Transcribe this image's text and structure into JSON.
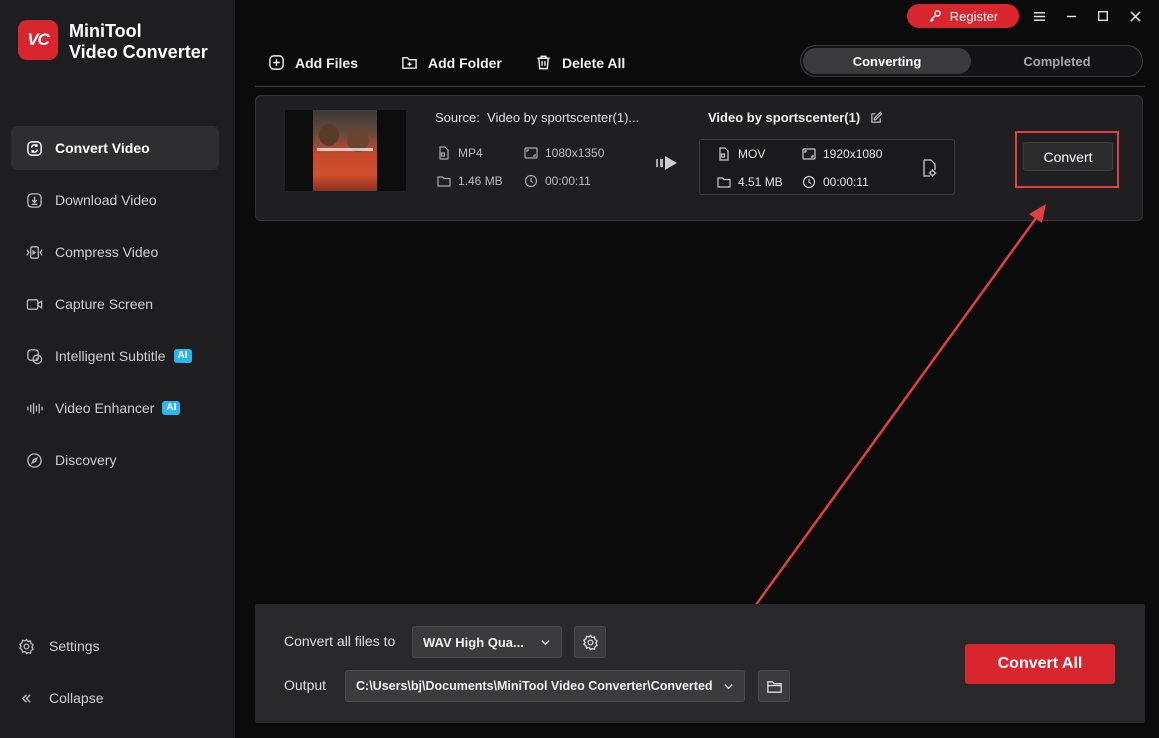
{
  "app": {
    "logo_text": "VC",
    "title_line1": "MiniTool",
    "title_line2": "Video Converter"
  },
  "titlebar": {
    "register_label": "Register"
  },
  "sidebar": {
    "items": [
      {
        "label": "Convert Video",
        "icon": "convert-icon",
        "active": true
      },
      {
        "label": "Download Video",
        "icon": "download-icon"
      },
      {
        "label": "Compress Video",
        "icon": "compress-icon"
      },
      {
        "label": "Capture Screen",
        "icon": "capture-icon"
      },
      {
        "label": "Intelligent Subtitle",
        "icon": "subtitle-icon",
        "badge": "AI"
      },
      {
        "label": "Video Enhancer",
        "icon": "enhancer-icon",
        "badge": "AI"
      },
      {
        "label": "Discovery",
        "icon": "compass-icon"
      }
    ],
    "settings_label": "Settings",
    "collapse_label": "Collapse"
  },
  "toolbar": {
    "add_files": "Add Files",
    "add_folder": "Add Folder",
    "delete_all": "Delete All"
  },
  "tabs": {
    "converting": "Converting",
    "completed": "Completed"
  },
  "file": {
    "source_label": "Source:",
    "source_name": "Video by sportscenter(1)...",
    "src_format": "MP4",
    "src_resolution": "1080x1350",
    "src_size": "1.46 MB",
    "src_duration": "00:00:11",
    "out_name": "Video by sportscenter(1)",
    "out_format": "MOV",
    "out_resolution": "1920x1080",
    "out_size": "4.51 MB",
    "out_duration": "00:00:11",
    "convert_label": "Convert"
  },
  "bottom": {
    "convert_all_to_label": "Convert all files to",
    "format_value": "WAV High Qua...",
    "output_label": "Output",
    "output_path": "C:\\Users\\bj\\Documents\\MiniTool Video Converter\\Converted",
    "convert_all_label": "Convert All"
  },
  "colors": {
    "accent": "#d9262e",
    "ai_badge": "#2ab7f0",
    "highlight": "#e04040"
  }
}
